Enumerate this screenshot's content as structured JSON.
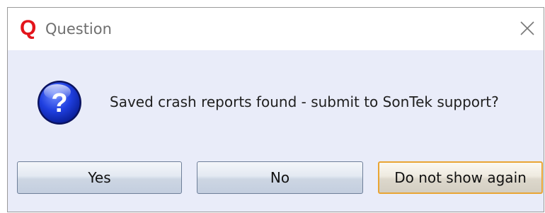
{
  "window": {
    "logo_letter": "Q",
    "title": "Question",
    "close_icon": "close-icon",
    "accent_color": "#e3141b"
  },
  "content": {
    "icon": "question-icon",
    "message": "Saved crash reports found - submit to SonTek support?"
  },
  "buttons": {
    "yes_label": "Yes",
    "no_label": "No",
    "dont_show_label": "Do not show again"
  }
}
